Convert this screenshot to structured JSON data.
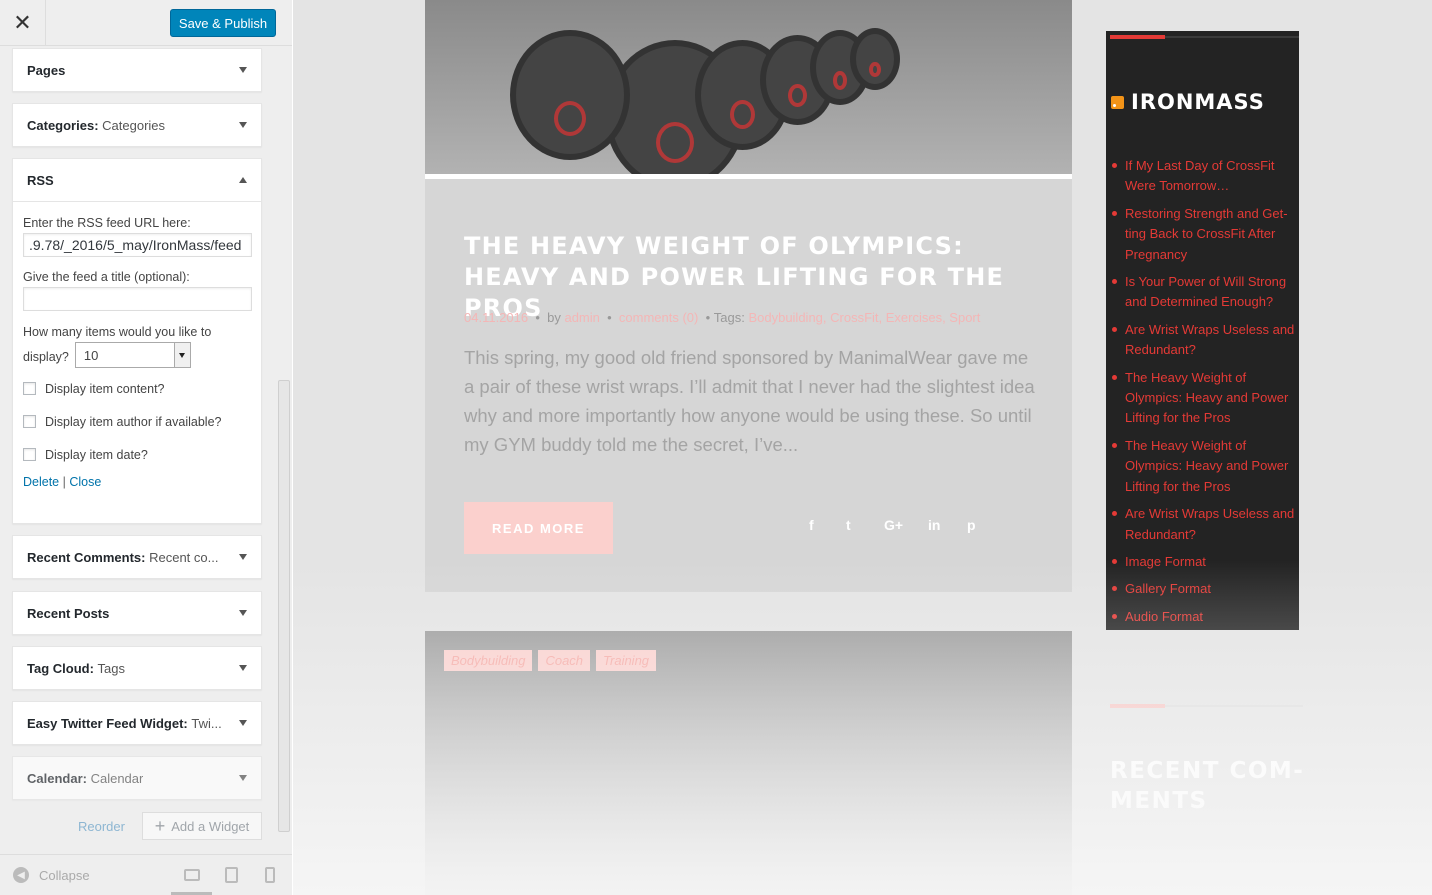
{
  "customizer": {
    "close_icon": "close-icon",
    "publish_label": "Save & Publish",
    "widgets": [
      {
        "title": "Pages",
        "subtitle": ""
      },
      {
        "title": "Categories",
        "subtitle": "Categories"
      },
      {
        "title": "RSS",
        "subtitle": ""
      },
      {
        "title": "Recent Comments",
        "subtitle": "Recent co..."
      },
      {
        "title": "Recent Posts",
        "subtitle": ""
      },
      {
        "title": "Tag Cloud",
        "subtitle": "Tags"
      },
      {
        "title": "Easy Twitter Feed Widget",
        "subtitle": "Twi..."
      },
      {
        "title": "Calendar",
        "subtitle": "Calendar"
      }
    ],
    "rss_form": {
      "url_label": "Enter the RSS feed URL here:",
      "url_value": ".9.78/_2016/5_may/IronMass/feed",
      "title_label": "Give the feed a title (optional):",
      "title_value": "",
      "items_label_1": "How many items would you like to",
      "items_label_2": "display?",
      "items_value": "10",
      "cb_content": "Display item content?",
      "cb_author": "Display item author if available?",
      "cb_date": "Display item date?",
      "delete_label": "Delete",
      "separator": "|",
      "close_label": "Close"
    },
    "reorder_label": "Reorder",
    "add_widget_label": "Add a Widget",
    "collapse_label": "Collapse"
  },
  "preview": {
    "post": {
      "title": "THE HEAVY WEIGHT OF OLYMPICS: HEAVY AND POWER LIFTING FOR THE PROS",
      "date": "04.11.2016",
      "by": "by",
      "author": "admin",
      "comments": "comments (0)",
      "tags_label": "Tags:",
      "tags": "Bodybuilding, CrossFit, Exercises, Sport",
      "excerpt": "This spring, my good old friend sponsored by ManimalWear gave me a pair of these wrist wraps. I’ll admit that I never had the slightest idea why and more importantly how anyone would be using these. So until my GYM buddy told me the secret, I’ve...",
      "read_more": "READ MORE",
      "share": [
        "f",
        "t",
        "G+",
        "in",
        "p"
      ]
    },
    "post2_tags": [
      "Bodybuilding",
      "Coach",
      "Training"
    ],
    "rss_widget": {
      "title": "IRONMASS",
      "items": [
        "If My Last Day of CrossFit Were Tomorrow…",
        "Restoring Strength and Get­ting Back to CrossFit After Pregnancy",
        "Is Your Power of Will Strong and Determined Enough?",
        "Are Wrist Wraps Useless and Redundant?",
        "The Heavy Weight of Olympics: Heavy and Power Lifting for the Pros",
        "The Heavy Weight of Olympics: Heavy and Power Lifting for the Pros",
        "Are Wrist Wraps Useless and Redundant?",
        "Image Format",
        "Gallery Format",
        "Audio Format"
      ]
    },
    "recent_comments_title": "RECENT COM-MENTS"
  },
  "colors": {
    "accent": "#e43a36",
    "publish": "#0085ba",
    "link": "#0073aa"
  }
}
